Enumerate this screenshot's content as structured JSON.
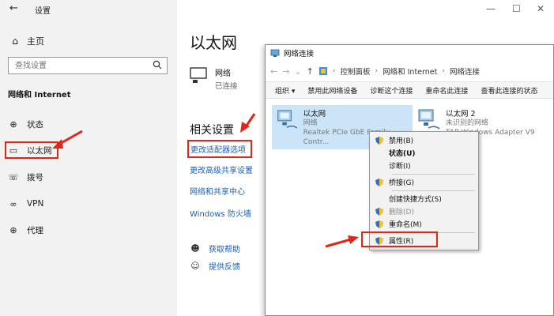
{
  "settings": {
    "title": "设置",
    "home_label": "主页",
    "search_placeholder": "查找设置",
    "section_heading": "网络和 Internet",
    "nav": [
      {
        "label": "状态",
        "icon": "status-icon"
      },
      {
        "label": "以太网",
        "icon": "ethernet-icon"
      },
      {
        "label": "拨号",
        "icon": "dialup-icon"
      },
      {
        "label": "VPN",
        "icon": "vpn-icon"
      },
      {
        "label": "代理",
        "icon": "proxy-icon"
      }
    ]
  },
  "main": {
    "title": "以太网",
    "adapter_name": "网络",
    "adapter_status": "已连接",
    "related_heading": "相关设置",
    "related_links": [
      "更改适配器选项",
      "更改高级共享设置",
      "网络和共享中心",
      "Windows 防火墙"
    ],
    "help_links": [
      "获取帮助",
      "提供反馈"
    ]
  },
  "netwin": {
    "title": "网络连接",
    "breadcrumb": [
      "控制面板",
      "网络和 Internet",
      "网络连接"
    ],
    "toolbar": [
      "组织 ▾",
      "禁用此网络设备",
      "诊断这个连接",
      "重命名此连接",
      "查看此连接的状态"
    ],
    "adapters": [
      {
        "name": "以太网",
        "status": "网络",
        "device": "Realtek PCIe GbE Family Contr..."
      },
      {
        "name": "以太网 2",
        "status": "未识别的网络",
        "device": "TAP-Windows Adapter V9"
      }
    ]
  },
  "context_menu": {
    "items": [
      {
        "label": "禁用(B)"
      },
      {
        "label": "状态(U)"
      },
      {
        "label": "诊断(I)"
      },
      {
        "label": "桥接(G)"
      },
      {
        "label": "创建快捷方式(S)"
      },
      {
        "label": "删除(D)"
      },
      {
        "label": "重命名(M)"
      },
      {
        "label": "属性(R)"
      }
    ]
  },
  "colors": {
    "accent_red": "#e0251b",
    "link_blue": "#1a5fb4",
    "selection": "#cce4f7",
    "left_pane_bg": "#f2f2f2"
  }
}
